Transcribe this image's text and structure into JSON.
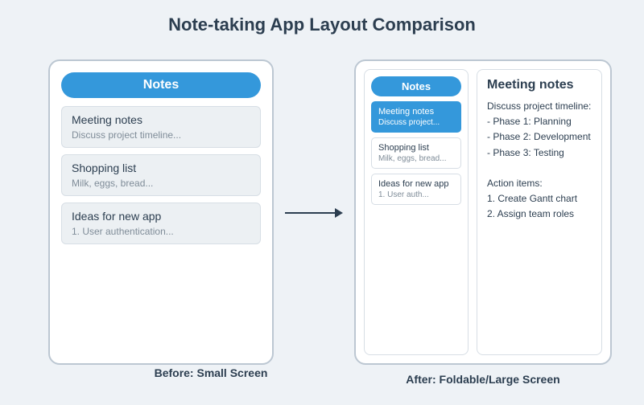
{
  "title": "Note-taking App Layout Comparison",
  "captions": {
    "before": "Before: Small Screen",
    "after": "After: Foldable/Large Screen"
  },
  "small": {
    "header": "Notes",
    "items": [
      {
        "title": "Meeting notes",
        "preview": "Discuss project timeline..."
      },
      {
        "title": "Shopping list",
        "preview": "Milk, eggs, bread..."
      },
      {
        "title": "Ideas for new app",
        "preview": "1. User authentication..."
      }
    ]
  },
  "large": {
    "list_header": "Notes",
    "items": [
      {
        "title": "Meeting notes",
        "preview": "Discuss project...",
        "selected": true
      },
      {
        "title": "Shopping list",
        "preview": "Milk, eggs, bread...",
        "selected": false
      },
      {
        "title": "Ideas for new app",
        "preview": "1. User auth...",
        "selected": false
      }
    ],
    "detail": {
      "title": "Meeting notes",
      "body": "Discuss project timeline:\n   - Phase 1: Planning\n   - Phase 2: Development\n   - Phase 3: Testing\n\nAction items:\n   1. Create Gantt chart\n   2. Assign team roles"
    }
  },
  "colors": {
    "accent": "#3498db",
    "text": "#2c3e50",
    "muted": "#7f8c98",
    "card_bg": "#ecf0f3",
    "border": "#d7dee5",
    "page_bg": "#eef2f6"
  }
}
